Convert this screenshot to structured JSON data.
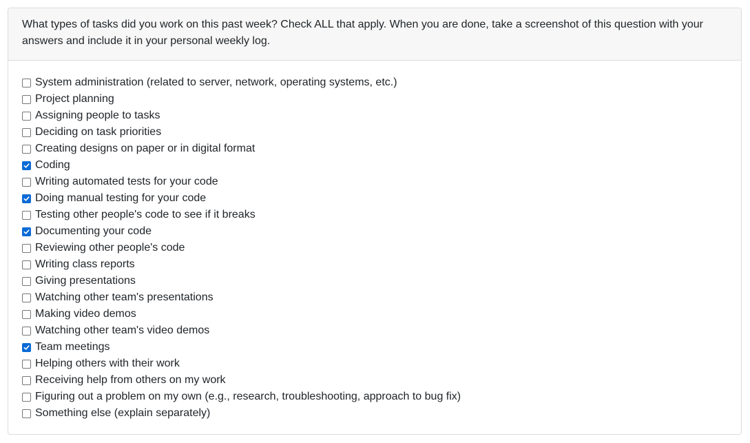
{
  "question": {
    "text": "What types of tasks did you work on this past week? Check ALL that apply. When you are done, take a screenshot of this question with your answers and include it in your personal weekly log."
  },
  "options": [
    {
      "label": "System administration (related to server, network, operating systems, etc.)",
      "checked": false
    },
    {
      "label": "Project planning",
      "checked": false
    },
    {
      "label": "Assigning people to tasks",
      "checked": false
    },
    {
      "label": "Deciding on task priorities",
      "checked": false
    },
    {
      "label": "Creating designs on paper or in digital format",
      "checked": false
    },
    {
      "label": "Coding",
      "checked": true
    },
    {
      "label": "Writing automated tests for your code",
      "checked": false
    },
    {
      "label": "Doing manual testing for your code",
      "checked": true
    },
    {
      "label": "Testing other people's code to see if it breaks",
      "checked": false
    },
    {
      "label": "Documenting your code",
      "checked": true
    },
    {
      "label": "Reviewing other people's code",
      "checked": false
    },
    {
      "label": "Writing class reports",
      "checked": false
    },
    {
      "label": "Giving presentations",
      "checked": false
    },
    {
      "label": "Watching other team's presentations",
      "checked": false
    },
    {
      "label": "Making video demos",
      "checked": false
    },
    {
      "label": "Watching other team's video demos",
      "checked": false
    },
    {
      "label": "Team meetings",
      "checked": true
    },
    {
      "label": "Helping others with their work",
      "checked": false
    },
    {
      "label": "Receiving help from others on my work",
      "checked": false
    },
    {
      "label": "Figuring out a problem on my own (e.g., research, troubleshooting, approach to bug fix)",
      "checked": false
    },
    {
      "label": "Something else (explain separately)",
      "checked": false
    }
  ],
  "colors": {
    "checked_fill": "#0b6bd6",
    "header_bg": "#f7f7f7",
    "border": "#dcdcdc",
    "text": "#212529"
  }
}
